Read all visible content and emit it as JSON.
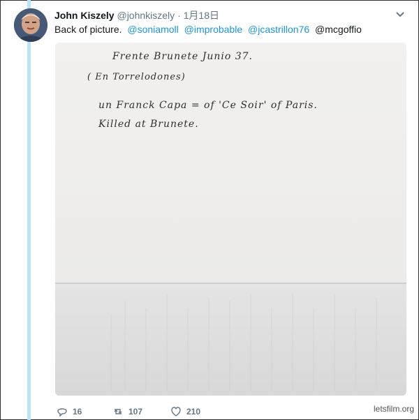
{
  "tweet": {
    "author_name": "John Kiszely",
    "author_handle": "@johnkiszely",
    "separator": "·",
    "date": "1月18日",
    "text_intro": "Back of picture.",
    "mentions": [
      "@soniamoll",
      "@improbable",
      "@jcastrillon76",
      "@mcgoffio"
    ],
    "stats": {
      "replies": "16",
      "retweets": "107",
      "likes": "210"
    }
  },
  "handwriting": {
    "line1": "Frente Brunete Junio 37.",
    "line2": "( En Torrelodones)",
    "line3": "un Franck Capa = of 'Ce Soir' of Paris.",
    "line4": "Killed at Brunete."
  },
  "watermark": "letsfilm.org",
  "icons": {
    "reply": "reply-icon",
    "retweet": "retweet-icon",
    "like": "heart-icon",
    "menu": "chevron-down-icon"
  },
  "colors": {
    "link": "#1b95e0",
    "thread_line": "#b9e4fa",
    "muted": "#657786"
  }
}
